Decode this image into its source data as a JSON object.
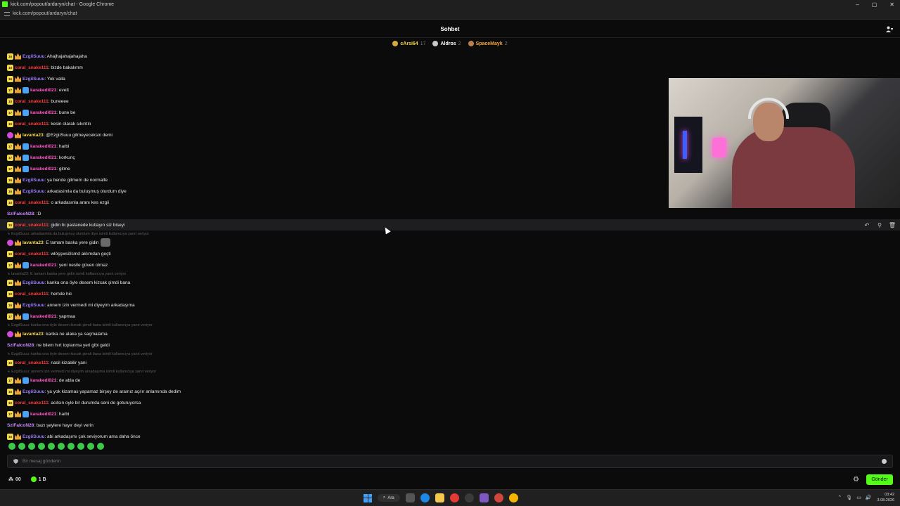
{
  "window": {
    "title": "kick.com/popout/ardaryn/chat - Google Chrome",
    "url": "kick.com/popout/ardaryn/chat",
    "controls": [
      "–",
      "▢",
      "✕"
    ]
  },
  "header": {
    "title": "Sohbet"
  },
  "leaderboard": [
    {
      "name": "cArsi64",
      "count": "17",
      "color": "#f4d84a",
      "medal": "#d9a93b"
    },
    {
      "name": "Aldros",
      "count": "2",
      "color": "#ffffff",
      "medal": "#c9c9c9"
    },
    {
      "name": "SpaceMayk",
      "count": "2",
      "color": "#f4a640",
      "medal": "#b8824a"
    }
  ],
  "colors": {
    "ezgi": "#9a7dff",
    "coral": "#ff3b3b",
    "karakedi": "#ff5ac8",
    "lavanta": "#f4d84a",
    "szlfalcon": "#c78bff",
    "accent": "#53fc18"
  },
  "messages": [
    {
      "user": "EzgiiSuuu",
      "text": ": Ahajhajahajahajaha"
    },
    {
      "user": "coral_snake111",
      "text": ": bizde bakalımm"
    },
    {
      "user": "EzgiiSuuu",
      "text": ": Yok valla"
    },
    {
      "user": "karakedi021",
      "text": ": evett"
    },
    {
      "user": "coral_snake111",
      "text": ": buneeee"
    },
    {
      "user": "karakedi021",
      "text": ": bune be"
    },
    {
      "user": "coral_snake111",
      "text": ": kesin olarak sıkıntılı"
    },
    {
      "user": "lavanta23",
      "text": ": @EzgiiSuuu gitmeyeceksin demi"
    },
    {
      "user": "karakedi021",
      "text": ": harbi"
    },
    {
      "user": "karakedi021",
      "text": ": korkunç"
    },
    {
      "user": "karakedi021",
      "text": ": gitme"
    },
    {
      "user": "EzgiiSuuu",
      "text": ": ya bende gitmem de normalfe"
    },
    {
      "user": "EzgiiSuuu",
      "text": ": arkadasimla da buluşmuş olurdum diye"
    },
    {
      "user": "coral_snake111",
      "text": ": o arkadasınla aranı kes ezgii"
    },
    {
      "user": "SzlFalcoN28",
      "text": ": :D"
    },
    {
      "user": "coral_snake111",
      "text": ": gidin bi pastanede kutlayın siz biseyi"
    },
    {
      "reply": "EzgiiSuuu: arkadasimla da buluşmuş olurdum diye isimli kullanıcıya yanıt veriyor"
    },
    {
      "user": "lavanta23",
      "text": ": E tamam baska yere gidin"
    },
    {
      "user": "coral_snake111",
      "text": ": wlöşşwsölsmd aklımdan geçti"
    },
    {
      "user": "karakedi021",
      "text": ": yeni nesile güven olmaz"
    },
    {
      "reply": "lavanta23: E tamam baska yere gidin isimli kullanıcıya yanıt veriyor"
    },
    {
      "user": "EzgiiSuuu",
      "text": ": kanka ona öyle desem kizcak şimdi bana"
    },
    {
      "user": "coral_snake111",
      "text": ": hemde hic"
    },
    {
      "user": "EzgiiSuuu",
      "text": ": annem izin vermedi mi diyeyim arkadaşıma"
    },
    {
      "user": "karakedi021",
      "text": ": yapmaa"
    },
    {
      "reply": "EzgiiSuuu: kanka ona öyle desem kizcak şimdi bana isimli kullanıcıya yanıt veriyor"
    },
    {
      "user": "lavanta23",
      "text": ": kanka ne alaka ya saçmalama"
    },
    {
      "user": "SzlFalcoN28",
      "text": ": ne bilem hırt toplanma yeri gibi geldi"
    },
    {
      "reply": "EzgiiSuuu: kanka ona öyle desem kizcak şimdi bana isimli kullanıcıya yanıt veriyor"
    },
    {
      "user": "coral_snake111",
      "text": ": nasil kizabilir yani"
    },
    {
      "reply": "EzgiiSuuu: annem izin vermedi mi diyeyim arkadaşıma isimli kullanıcıya yanıt veriyor"
    },
    {
      "user": "karakedi021",
      "text": ": de abla de"
    },
    {
      "user": "EzgiiSuuu",
      "text": ": ya yok kizamas yapamaz birşey de aramız açılır anlamında dedim"
    },
    {
      "user": "coral_snake111",
      "text": ": acılsın oyle bir durumda seni de goturuyorsa"
    },
    {
      "user": "karakedi021",
      "text": ": harbi"
    },
    {
      "user": "SzlFalcoN28",
      "text": ": bazı şeylere hayır deyi verin"
    },
    {
      "user": "EzgiiSuuu",
      "text": ": abi arkadaşımı çok seviyorum ama daha önce"
    }
  ],
  "input": {
    "placeholder": "Bir mesaj gönderin",
    "value": ""
  },
  "footer": {
    "left_count": "00",
    "kick_points": "1 B",
    "send_label": "Gönder"
  },
  "taskbar": {
    "search_label": "Ara",
    "time": "03:42",
    "date": "3.08.2026"
  }
}
